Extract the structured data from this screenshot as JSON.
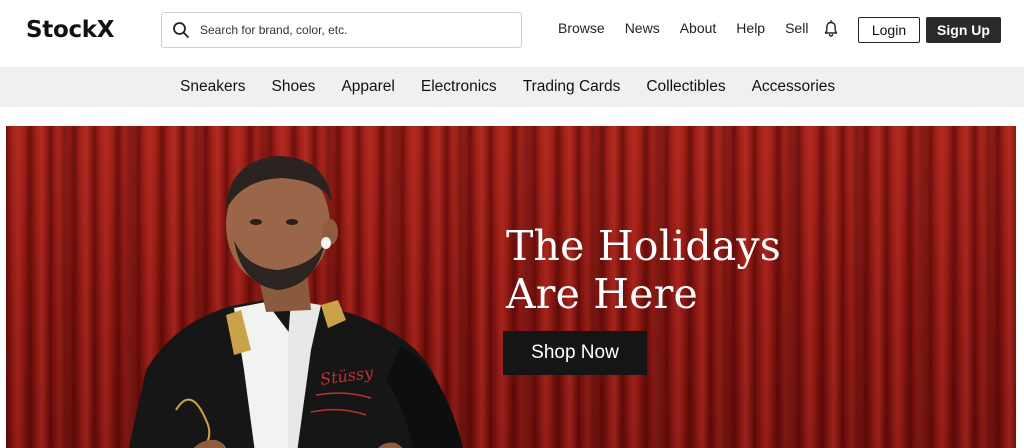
{
  "header": {
    "logo_text": "StockX",
    "search": {
      "placeholder": "Search for brand, color, etc.",
      "value": ""
    },
    "nav": [
      "Browse",
      "News",
      "About",
      "Help",
      "Sell"
    ],
    "login_label": "Login",
    "signup_label": "Sign Up",
    "icons": {
      "search": "search-icon",
      "notifications": "bell-icon"
    }
  },
  "categories": [
    "Sneakers",
    "Shoes",
    "Apparel",
    "Electronics",
    "Trading Cards",
    "Collectibles",
    "Accessories"
  ],
  "hero": {
    "title_line1": "The Holidays",
    "title_line2": "Are Here",
    "cta_label": "Shop Now",
    "jacket_text": "Stüssy"
  },
  "colors": {
    "accent_dark": "#2a2a2a",
    "category_bar": "#f0f0ef",
    "hero_red": "#8e1812",
    "cta_bg": "#151515"
  }
}
